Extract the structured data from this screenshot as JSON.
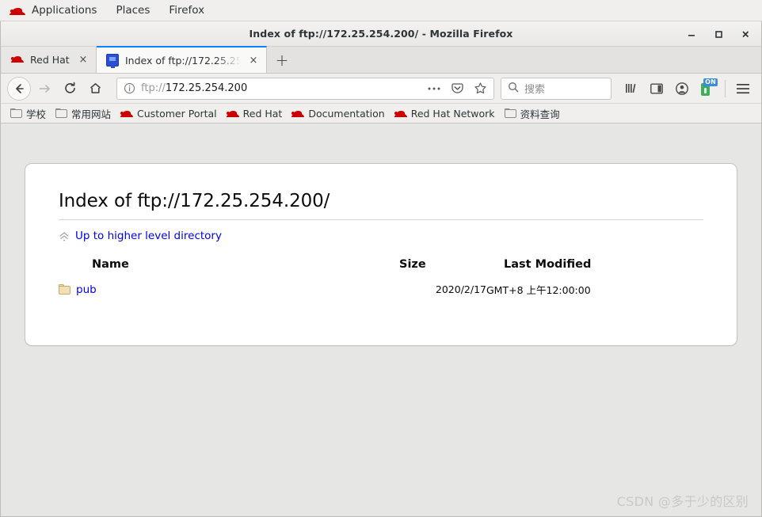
{
  "desktop": {
    "panel_items": [
      {
        "label": "Applications",
        "icon": "red-hat-logo-icon"
      },
      {
        "label": "Places",
        "icon": ""
      },
      {
        "label": "Firefox",
        "icon": ""
      }
    ]
  },
  "window": {
    "title": "Index of ftp://172.25.254.200/ - Mozilla Firefox",
    "controls": {
      "minimize": "minimize-icon",
      "maximize": "maximize-icon",
      "close": "close-icon"
    }
  },
  "tabs": [
    {
      "title": "Red Hat",
      "favicon": "red-hat-favicon",
      "active": false,
      "close": "×"
    },
    {
      "title": "Index of ftp://172.25.254.200/",
      "favicon": "monitor-favicon",
      "active": true,
      "close": "×"
    }
  ],
  "newtab_label": "+",
  "navigation": {
    "back": "back-arrow-icon",
    "forward": "forward-arrow-icon",
    "reload": "reload-icon",
    "home": "home-icon"
  },
  "urlbar": {
    "identity_icon": "info-circle-icon",
    "scheme": "ftp://",
    "host": "172.25.254.200",
    "page_actions_icon": "ellipsis-icon",
    "pocket_icon": "pocket-icon",
    "bookmark_icon": "star-icon"
  },
  "search": {
    "icon": "search-icon",
    "placeholder": "搜索"
  },
  "toolbar_right": {
    "library": "library-icon",
    "sidebar": "sidebar-icon",
    "account": "account-icon",
    "extension": {
      "icon": "extension-bottle-icon",
      "badge": "ON"
    },
    "menu": "hamburger-menu-icon"
  },
  "bookmarks": [
    {
      "label": "学校",
      "icon": "folder-icon"
    },
    {
      "label": "常用网站",
      "icon": "folder-icon"
    },
    {
      "label": "Customer Portal",
      "icon": "red-hat-favicon"
    },
    {
      "label": "Red Hat",
      "icon": "red-hat-favicon"
    },
    {
      "label": "Documentation",
      "icon": "red-hat-favicon"
    },
    {
      "label": "Red Hat Network",
      "icon": "red-hat-favicon"
    },
    {
      "label": "资料查询",
      "icon": "folder-icon"
    }
  ],
  "page": {
    "heading": "Index of ftp://172.25.254.200/",
    "up_directory": {
      "label": "Up to higher level directory",
      "icon": "up-chevron-icon"
    },
    "table": {
      "columns": [
        "Name",
        "Size",
        "Last Modified"
      ],
      "rows": [
        {
          "name": "pub",
          "icon": "folder-icon",
          "size": "",
          "modified_date": "2020/2/17",
          "modified_time": "GMT+8 上午12:00:00"
        }
      ]
    }
  },
  "watermark": "CSDN @多于少的区别",
  "colors": {
    "link": "#0000EE",
    "tab_accent": "#0A84FF",
    "red_hat": "#CC0000",
    "extension_badge": "#3B8DD8",
    "extension_body": "#3FAE5A",
    "folder": "#F3DFB4"
  }
}
